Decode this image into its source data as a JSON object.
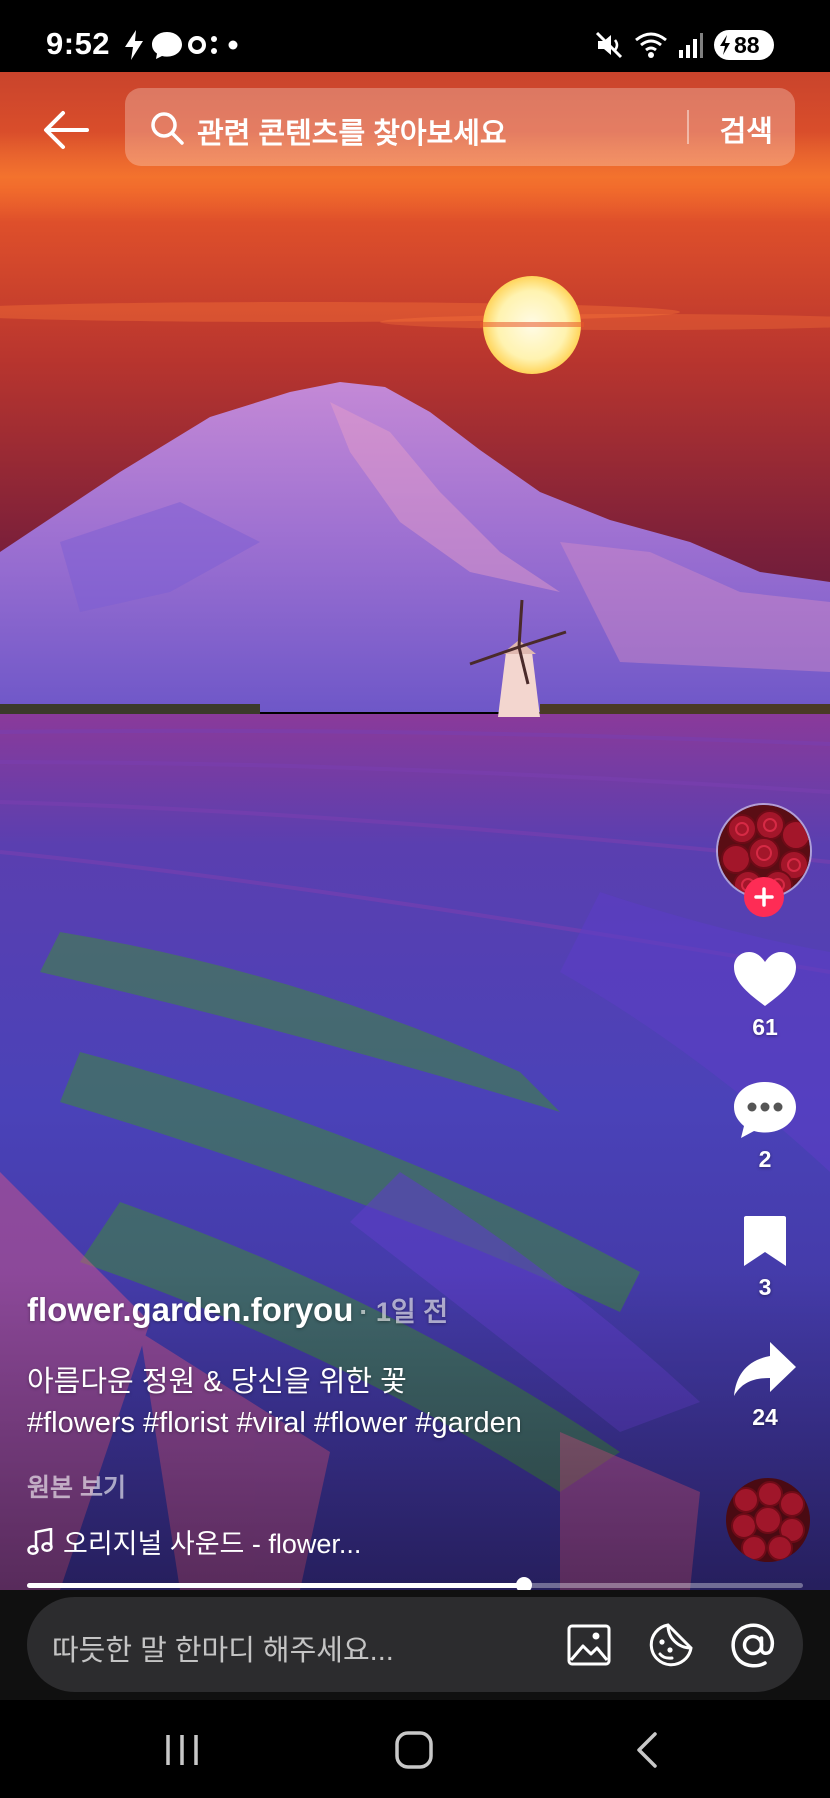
{
  "status_bar": {
    "time": "9:52",
    "battery": "88",
    "icons": [
      "charging-bolt-icon",
      "messenger-icon",
      "dots-app-icon",
      "notification-dot-icon",
      "mute-icon",
      "wifi-icon",
      "signal-icon"
    ]
  },
  "search": {
    "placeholder": "관련 콘텐츠를 찾아보세요",
    "submit_label": "검색"
  },
  "post": {
    "author": "flower.garden.foryou",
    "time": "· 1일 전",
    "caption": "아름다운 정원 & 당신을 위한 꽃",
    "hashtags": "#flowers #florist #viral #flower #garden",
    "see_original": "원본 보기",
    "music": "오리지널 사운드 - flower..."
  },
  "actions": {
    "likes": "61",
    "comments": "2",
    "saves": "3",
    "shares": "24"
  },
  "progress": {
    "fraction": 0.64
  },
  "composer": {
    "placeholder": "따듯한 말 한마디 해주세요..."
  },
  "colors": {
    "accent": "#fe2c55",
    "input_bg": "#2c2c2e"
  }
}
